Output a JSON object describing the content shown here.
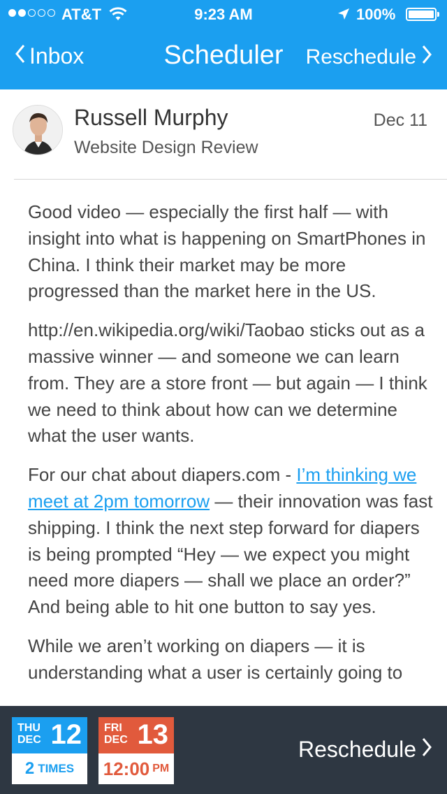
{
  "status_bar": {
    "carrier": "AT&T",
    "time": "9:23 AM",
    "battery": "100%",
    "signal_bars_filled": 2,
    "signal_bars_total": 5
  },
  "nav": {
    "back_label": "Inbox",
    "title": "Scheduler",
    "right_label": "Reschedule"
  },
  "email": {
    "sender": "Russell Murphy",
    "subject": "Website Design Review",
    "date": "Dec 11",
    "paragraphs": {
      "p1": "Good video — especially the first half — with insight into what is happening on SmartPhones in China. I think their market may be more progressed than the market here in the US.",
      "p2": "http://en.wikipedia.org/wiki/Taobao sticks out as a massive winner — and someone we can learn from. They are a store front — but again — I think we need to think about how can we determine what the user wants.",
      "p3_before": "For our chat about diapers.com - ",
      "p3_link": "I’m thinking we meet at 2pm tomorrow",
      "p3_after": " — their innovation was fast shipping. I think the next step forward for diapers is being prompted “Hey — we expect you might need more diapers — shall we place an order?” And being able to hit one button to say yes.",
      "p4": "While we aren’t working on diapers — it is understanding what a user is certainly going to"
    }
  },
  "bottom_bar": {
    "option1": {
      "dow": "THU",
      "month": "DEC",
      "day": "12",
      "count": "2",
      "count_label": "TIMES"
    },
    "option2": {
      "dow": "FRI",
      "month": "DEC",
      "day": "13",
      "time": "12:00",
      "ampm": "PM"
    },
    "action_label": "Reschedule"
  },
  "colors": {
    "accent": "#1b9ff0",
    "option2": "#e15a3c",
    "bottom_bar": "#1e2834"
  }
}
